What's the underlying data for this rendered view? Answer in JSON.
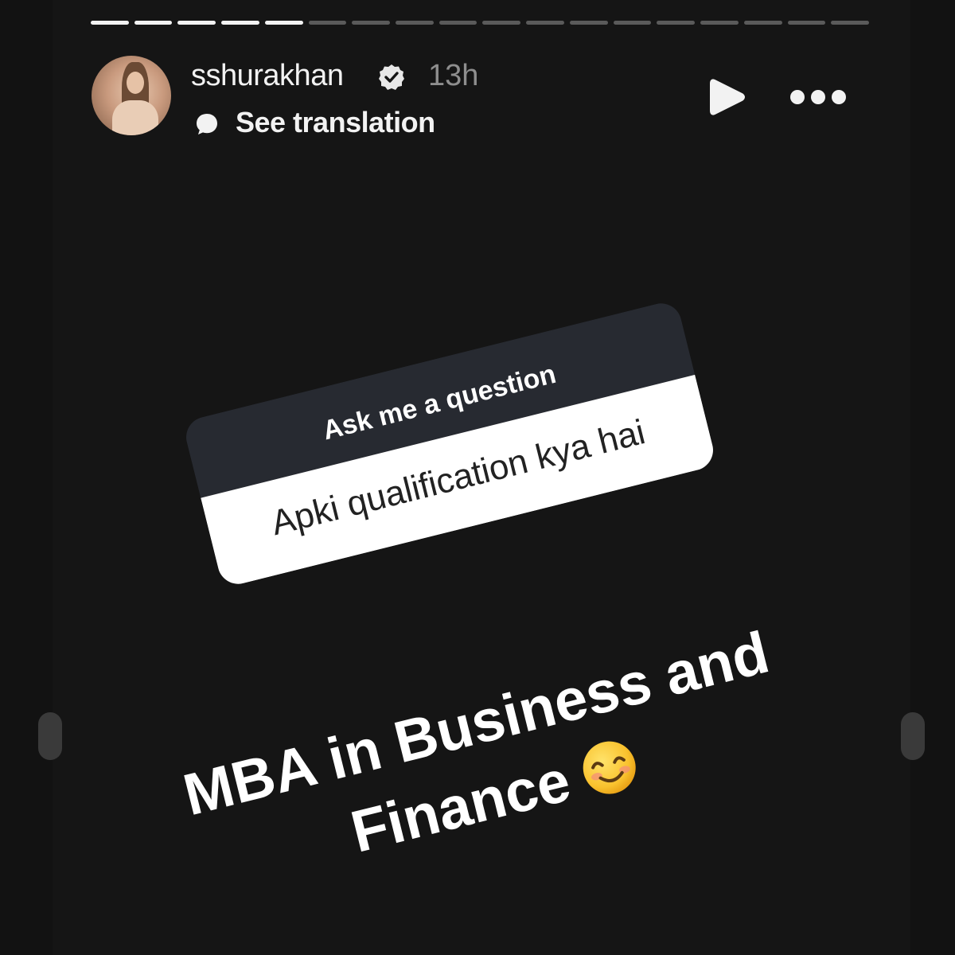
{
  "story": {
    "progress": {
      "total_segments": 18,
      "completed_segments": 5
    },
    "header": {
      "username": "sshurakhan",
      "verified_icon": "verified-badge-icon",
      "timestamp": "13h",
      "translate_icon": "speech-bubble-icon",
      "translate_label": "See translation",
      "play_icon": "play-icon",
      "more_icon": "more-options-icon"
    },
    "question_sticker": {
      "header": "Ask me a question",
      "question": "Apki qualification kya hai"
    },
    "answer": {
      "line1": "MBA in Business and",
      "line2": "Finance",
      "emoji": "smiling-face-emoji"
    }
  }
}
